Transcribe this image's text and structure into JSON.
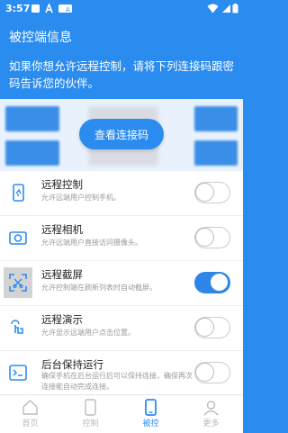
{
  "status_bar": {
    "time": "3:57"
  },
  "header": {
    "title": "被控端信息"
  },
  "banner": {
    "text": "如果你想允许远程控制，请将下列连接码跟密码告诉您的伙伴。"
  },
  "credentials": {
    "view_button_label": "查看连接码"
  },
  "features": [
    {
      "name": "远程控制",
      "desc": "允许远端用户控制手机。",
      "enabled": false,
      "icon": "phone-remote-icon"
    },
    {
      "name": "远程相机",
      "desc": "允许远端用户直接访问摄像头。",
      "enabled": false,
      "icon": "camera-icon"
    },
    {
      "name": "远程截屏",
      "desc": "允许控制端在刷新列表时自动截屏。",
      "enabled": true,
      "icon": "screenshot-icon"
    },
    {
      "name": "远程演示",
      "desc": "允许显示远端用户点击位置。",
      "enabled": false,
      "icon": "touch-demo-icon"
    },
    {
      "name": "后台保持运行",
      "desc": "确保手机在后台运行后可以保持连接，确保再次连接能自动完成连接。",
      "enabled": false,
      "icon": "terminal-icon"
    }
  ],
  "tabs": [
    {
      "label": "首页",
      "icon": "home-icon",
      "active": false
    },
    {
      "label": "控制",
      "icon": "control-icon",
      "active": false
    },
    {
      "label": "被控",
      "icon": "controlled-icon",
      "active": true
    },
    {
      "label": "更多",
      "icon": "more-icon",
      "active": false
    }
  ],
  "colors": {
    "primary": "#2b8cf0",
    "toggle_on": "#2f86e8"
  }
}
